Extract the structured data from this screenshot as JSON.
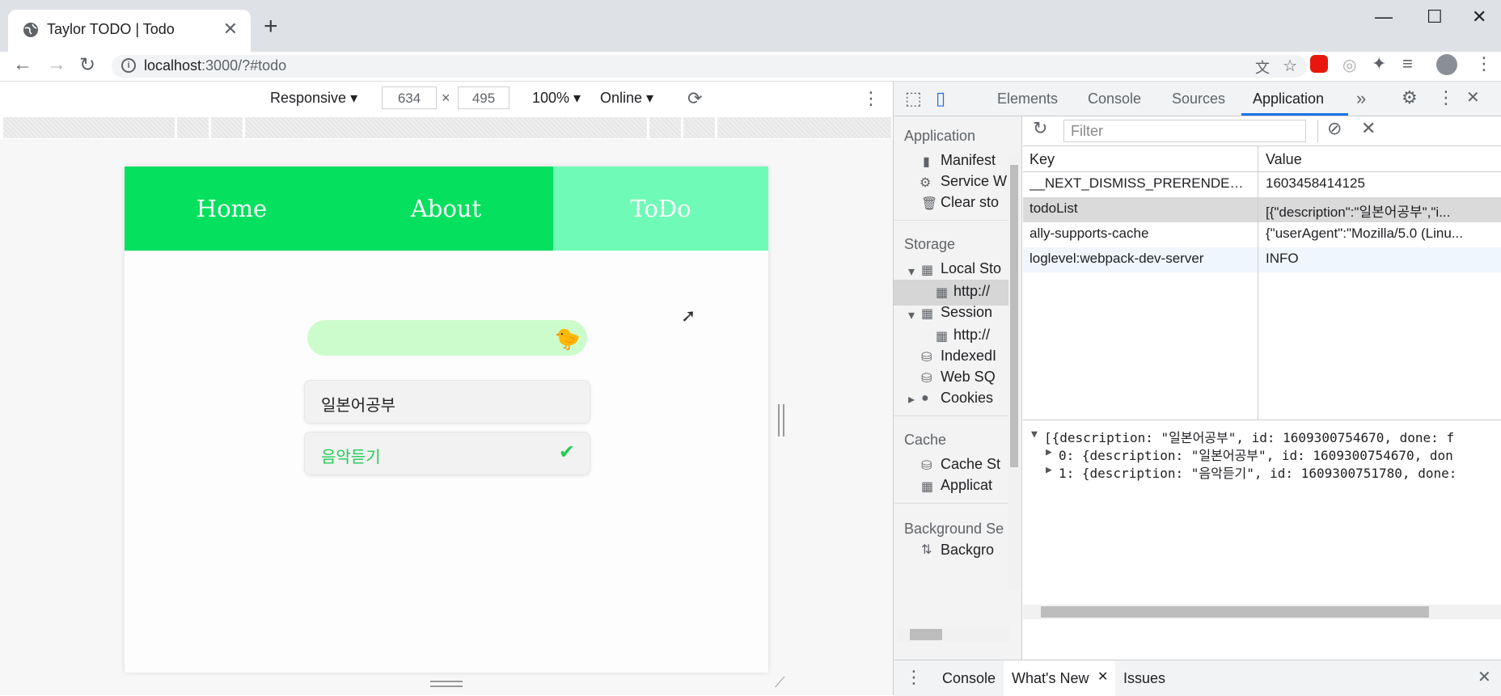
{
  "browser": {
    "tab_title": "Taylor TODO | Todo",
    "url_host": "localhost",
    "url_rest": ":3000/?#todo",
    "new_tab": "+",
    "close": "✕"
  },
  "device_toolbar": {
    "mode": "Responsive",
    "width": "634",
    "times": "×",
    "height": "495",
    "zoom": "100%",
    "network": "Online"
  },
  "app": {
    "nav": [
      "Home",
      "About",
      "ToDo"
    ],
    "active_nav": "ToDo",
    "input_value": "",
    "todos": [
      {
        "text": "일본어공부",
        "done": false
      },
      {
        "text": "음악듣기",
        "done": true
      }
    ]
  },
  "devtools": {
    "tabs": [
      "Elements",
      "Console",
      "Sources",
      "Application"
    ],
    "active_tab": "Application",
    "filter_placeholder": "Filter",
    "sidebar": {
      "application_header": "Application",
      "application_items": [
        "Manifest",
        "Service W",
        "Clear sto"
      ],
      "storage_header": "Storage",
      "local_storage": "Local Sto",
      "local_storage_child": "http://",
      "session_storage": "Session",
      "session_storage_child": "http://",
      "storage_items": [
        "IndexedI",
        "Web SQ",
        "Cookies"
      ],
      "cache_header": "Cache",
      "cache_items": [
        "Cache St",
        "Applicat"
      ],
      "background_header": "Background Se",
      "background_item": "Backgro"
    },
    "table": {
      "col_key": "Key",
      "col_value": "Value",
      "rows": [
        {
          "key": "__NEXT_DISMISS_PRERENDER_...",
          "value": "1603458414125"
        },
        {
          "key": "todoList",
          "value": "[{\"description\":\"일본어공부\",\"i..."
        },
        {
          "key": "ally-supports-cache",
          "value": "{\"userAgent\":\"Mozilla/5.0 (Linu..."
        },
        {
          "key": "loglevel:webpack-dev-server",
          "value": "INFO"
        }
      ],
      "selected_row": 1
    },
    "preview": [
      "[{description: \"일본어공부\", id: 1609300754670, done: f",
      "0: {description: \"일본어공부\", id: 1609300754670, don",
      "1: {description: \"음악듣기\", id: 1609300751780, done:"
    ],
    "drawer_tabs": [
      "Console",
      "What's New",
      "Issues"
    ],
    "active_drawer_tab": "What's New"
  }
}
